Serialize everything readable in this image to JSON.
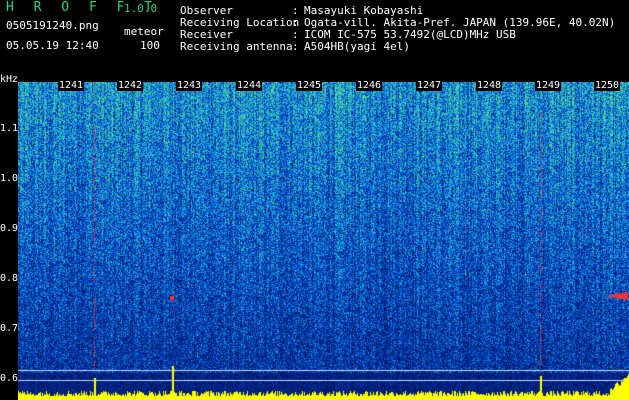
{
  "header": {
    "app_title": "H R O F F T",
    "app_version": "1.0.0",
    "filename": "0505191240.png",
    "mode": "meteor",
    "datetime": "05.05.19 12:40",
    "count": "100",
    "fields": [
      {
        "label": "Observer",
        "value": "Masayuki Kobayashi"
      },
      {
        "label": "Receiving Location",
        "value": "Ogata-vill. Akita-Pref. JAPAN (139.96E, 40.02N)"
      },
      {
        "label": "Receiver",
        "value": "ICOM IC-575 53.7492(@LCD)MHz USB"
      },
      {
        "label": "Receiving antenna",
        "value": "A504HB(yagi 4el)"
      }
    ]
  },
  "axis": {
    "unit": "kHz",
    "y_ticks": [
      "1.1",
      "1.0",
      "0.9",
      "0.8",
      "0.7",
      "0.6"
    ],
    "minutes": [
      "1241",
      "1242",
      "1243",
      "1244",
      "1245",
      "1246",
      "1247",
      "1248",
      "1249",
      "1250"
    ]
  },
  "colors": {
    "background": "#000000",
    "title_green": "#33d17a",
    "spectrogram_low": "#00105a",
    "spectrogram_mid": "#1560d8",
    "spectrogram_high": "#3fe0c0",
    "meteor_trace": "#ff3030",
    "baseline_yellow": "#ffff00"
  }
}
